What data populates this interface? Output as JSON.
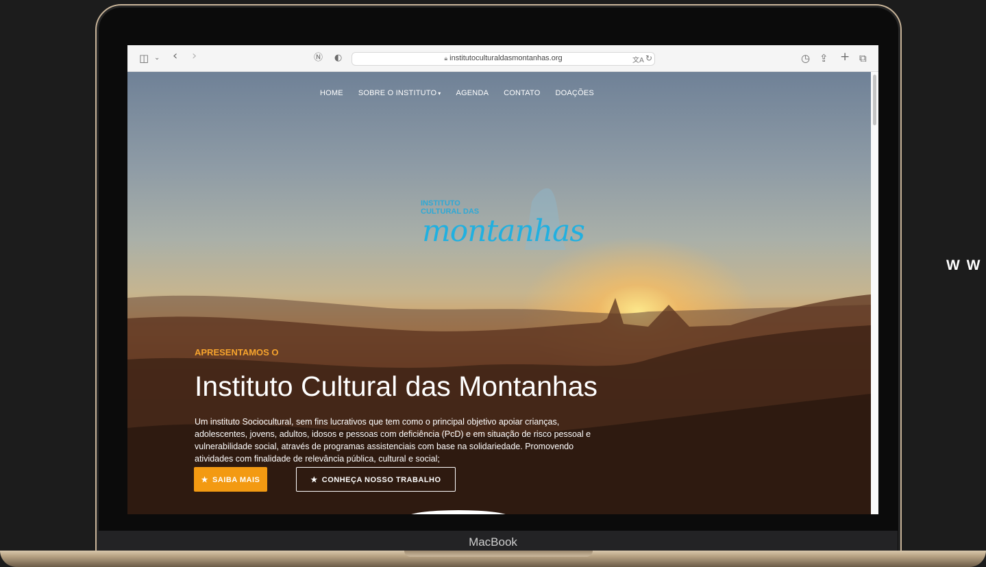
{
  "side_text": "W W",
  "device": {
    "label": "MacBook"
  },
  "browser": {
    "url": "institutoculturaldasmontanhas.org",
    "icons": [
      "sidebar-icon",
      "chevron-down-icon",
      "back-icon",
      "forward-icon",
      "notion-icon",
      "shield-icon",
      "lock-icon",
      "translate-icon",
      "reload-icon",
      "history-icon",
      "share-icon",
      "new-tab-icon",
      "tabs-icon"
    ]
  },
  "site": {
    "nav": {
      "home": "HOME",
      "sobre": "SOBRE O INSTITUTO",
      "agenda": "AGENDA",
      "contato": "CONTATO",
      "doacoes": "DOAÇÕES"
    },
    "logo": {
      "line1": "INSTITUTO",
      "line2": "CULTURAL DAS",
      "script": "montanhas"
    },
    "hero": {
      "eyebrow": "APRESENTAMOS O",
      "title": "Instituto Cultural das Montanhas",
      "description": "Um instituto Sociocultural, sem fins lucrativos que tem como o principal objetivo apoiar crianças, adolescentes, jovens, adultos, idosos e pessoas com deficiência (PcD) e em situação de risco pessoal e vulnerabilidade social, através de programas assistenciais com base na solidariedade. Promovendo atividades com finalidade de relevância pública, cultural e social;",
      "primary_button": "SAIBA MAIS",
      "secondary_button": "CONHEÇA NOSSO TRABALHO"
    },
    "colors": {
      "accent": "#f39a12",
      "logo": "#21b0e0",
      "eyebrow": "#f7a42d"
    }
  }
}
